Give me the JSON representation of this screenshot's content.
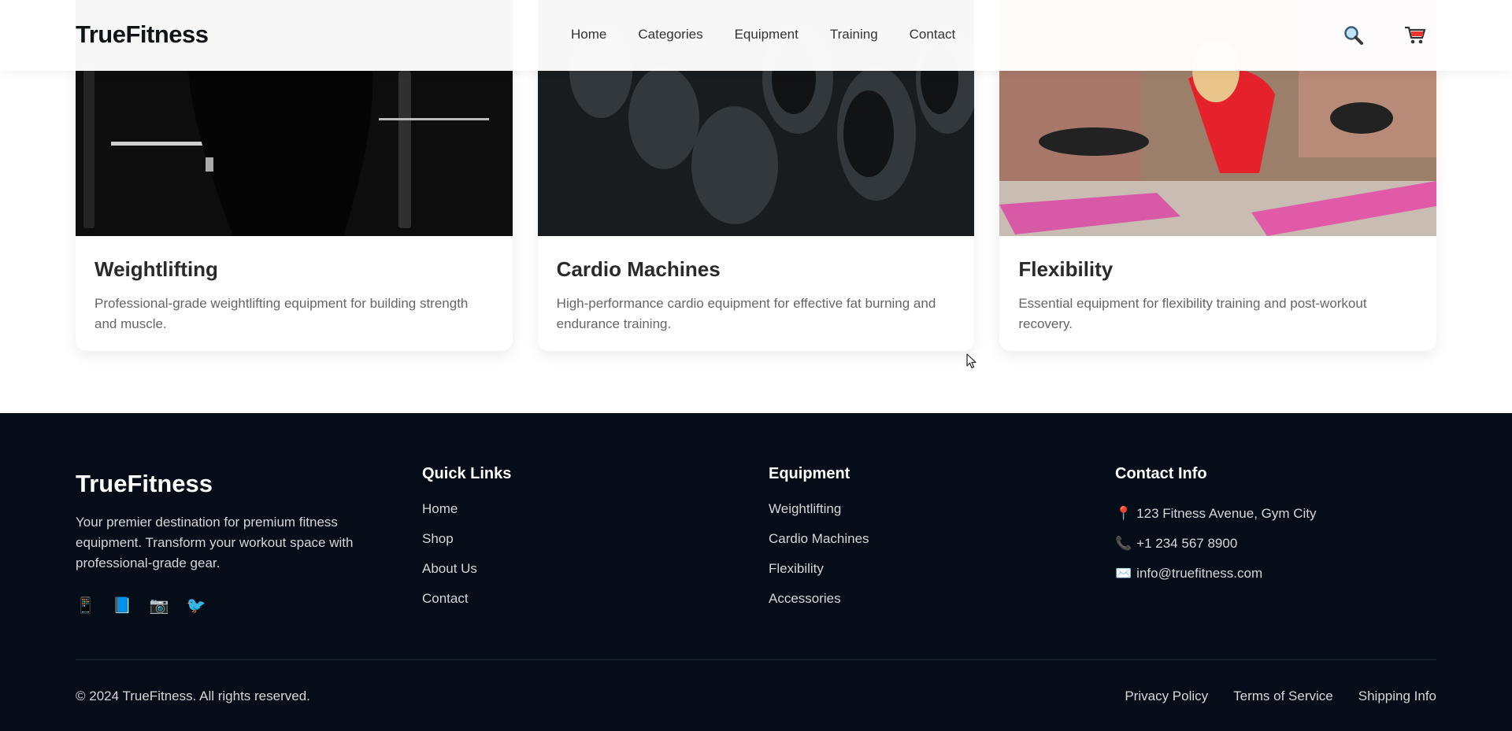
{
  "header": {
    "logo": "TrueFitness",
    "nav": [
      "Home",
      "Categories",
      "Equipment",
      "Training",
      "Contact"
    ],
    "search_icon": "search-icon",
    "cart_icon": "cart-icon"
  },
  "cards": [
    {
      "title": "Weightlifting",
      "description": "Professional-grade weightlifting equipment for building strength and muscle."
    },
    {
      "title": "Cardio Machines",
      "description": "High-performance cardio equipment for effective fat burning and endurance training."
    },
    {
      "title": "Flexibility",
      "description": "Essential equipment for flexibility training and post-workout recovery."
    }
  ],
  "footer": {
    "logo": "TrueFitness",
    "about": "Your premier destination for premium fitness equipment. Transform your workout space with professional-grade gear.",
    "socials": [
      "📱",
      "📘",
      "📷",
      "🐦"
    ],
    "quick_links": {
      "title": "Quick Links",
      "items": [
        "Home",
        "Shop",
        "About Us",
        "Contact"
      ]
    },
    "equipment": {
      "title": "Equipment",
      "items": [
        "Weightlifting",
        "Cardio Machines",
        "Flexibility",
        "Accessories"
      ]
    },
    "contact": {
      "title": "Contact Info",
      "address_icon": "📍",
      "address": "123 Fitness Avenue, Gym City",
      "phone_icon": "📞",
      "phone": "+1 234 567 8900",
      "email_icon": "✉️",
      "email": "info@truefitness.com"
    },
    "copyright": "© 2024 TrueFitness. All rights reserved.",
    "legal": [
      "Privacy Policy",
      "Terms of Service",
      "Shipping Info"
    ]
  },
  "colors": {
    "footer_bg": "#050d18",
    "accent_pink": "#e05aa8"
  }
}
